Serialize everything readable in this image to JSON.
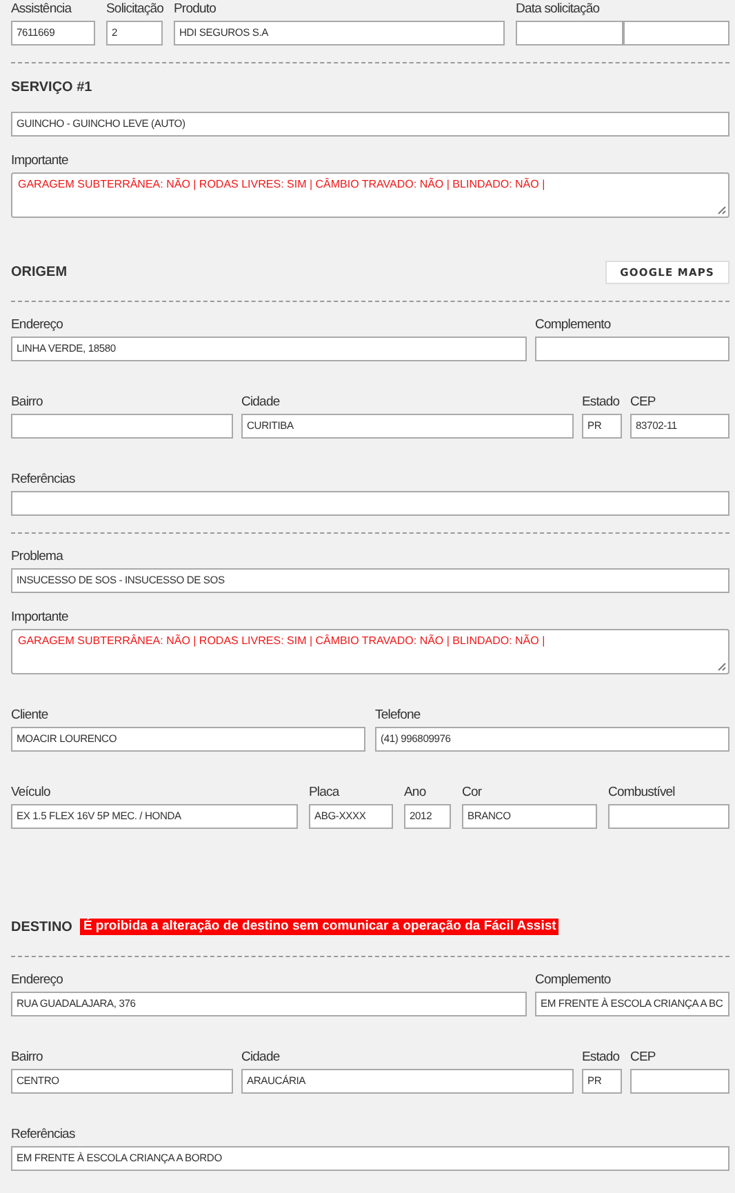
{
  "blocks": [
    {
      "kind": "id-row",
      "fields": [
        {
          "label": "Assistência",
          "value": "7611669",
          "kind": "input"
        },
        {
          "label": "Solicitação",
          "value": "2",
          "kind": "input"
        },
        {
          "label": "Produto",
          "value": "HDI SEGUROS S.A",
          "kind": "input"
        },
        {
          "label": "Data solicitação",
          "kind": "date-pair"
        }
      ]
    },
    {
      "kind": "divider"
    },
    {
      "kind": "heading",
      "title": "SERVIÇO #1"
    },
    {
      "kind": "full-row",
      "fields": [
        {
          "value": "GUINCHO - GUINCHO LEVE (AUTO)",
          "kind": "input"
        }
      ]
    },
    {
      "kind": "full-row",
      "fields": [
        {
          "label": "Importante",
          "value": "GARAGEM SUBTERRÂNEA: NÃO | RODAS LIVRES: SIM | CÂMBIO TRAVADO: NÃO | BLINDADO: NÃO |",
          "kind": "textarea"
        }
      ]
    },
    {
      "kind": "heading",
      "title": "ORIGEM",
      "button": "GOOGLE MAPS"
    },
    {
      "kind": "divider"
    },
    {
      "kind": "address-row",
      "fields": [
        {
          "label": "Endereço",
          "value": "LINHA VERDE, 18580",
          "kind": "input"
        },
        {
          "label": "Complemento",
          "kind": "input"
        }
      ]
    },
    {
      "kind": "locality-row",
      "fields": [
        {
          "label": "Bairro",
          "kind": "input"
        },
        {
          "label": "Cidade",
          "value": "CURITIBA",
          "kind": "input"
        },
        {
          "label": "Estado",
          "value": "PR",
          "kind": "input"
        },
        {
          "label": "CEP",
          "value": "83702-11",
          "kind": "input"
        }
      ]
    },
    {
      "kind": "full-row",
      "fields": [
        {
          "label": "Referências",
          "kind": "input"
        }
      ]
    },
    {
      "kind": "divider"
    },
    {
      "kind": "full-row",
      "fields": [
        {
          "label": "Problema",
          "value": "INSUCESSO DE SOS - INSUCESSO DE SOS",
          "kind": "input"
        }
      ]
    },
    {
      "kind": "full-row",
      "fields": [
        {
          "label": "Importante",
          "value": "GARAGEM SUBTERRÂNEA: NÃO | RODAS LIVRES: SIM | CÂMBIO TRAVADO: NÃO | BLINDADO: NÃO |",
          "kind": "textarea"
        }
      ]
    },
    {
      "kind": "contact-row",
      "fields": [
        {
          "label": "Cliente",
          "value": "MOACIR LOURENCO",
          "kind": "input"
        },
        {
          "label": "Telefone",
          "value": "(41) 996809976",
          "kind": "input"
        }
      ]
    },
    {
      "kind": "vehicle-row",
      "fields": [
        {
          "label": "Veículo",
          "value": "EX 1.5 FLEX 16V 5P MEC. / HONDA",
          "kind": "input"
        },
        {
          "label": "Placa",
          "value": "ABG-XXXX",
          "kind": "input"
        },
        {
          "label": "Ano",
          "value": "2012",
          "kind": "input"
        },
        {
          "label": "Cor",
          "value": "BRANCO",
          "kind": "input"
        },
        {
          "label": "Combustível",
          "kind": "input"
        }
      ]
    },
    {
      "kind": "heading",
      "title": "DESTINO",
      "warning": "É proibida a alteração de destino sem comunicar a operação da Fácil Assist"
    },
    {
      "kind": "divider"
    },
    {
      "kind": "address-row",
      "fields": [
        {
          "label": "Endereço",
          "value": "RUA GUADALAJARA, 376",
          "kind": "input"
        },
        {
          "label": "Complemento",
          "value": "EM FRENTE À ESCOLA CRIANÇA A BC",
          "kind": "input"
        }
      ]
    },
    {
      "kind": "locality-row",
      "fields": [
        {
          "label": "Bairro",
          "value": "CENTRO",
          "kind": "input"
        },
        {
          "label": "Cidade",
          "value": "ARAUCÁRIA",
          "kind": "input"
        },
        {
          "label": "Estado",
          "value": "PR",
          "kind": "input"
        },
        {
          "label": "CEP",
          "kind": "input"
        }
      ]
    },
    {
      "kind": "full-row",
      "fields": [
        {
          "label": "Referências",
          "value": "EM FRENTE À ESCOLA CRIANÇA A BORDO",
          "kind": "input"
        }
      ]
    }
  ]
}
